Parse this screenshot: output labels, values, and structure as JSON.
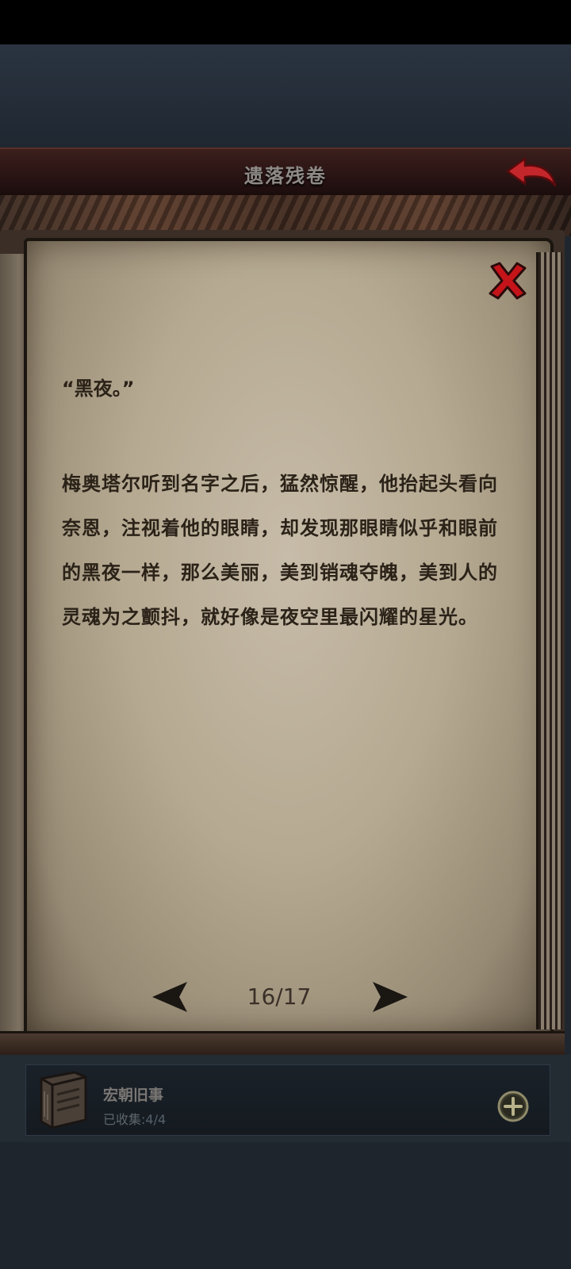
{
  "header": {
    "title": "遗落残卷",
    "back_icon": "back-arrow-icon"
  },
  "reader": {
    "close_icon": "close-x-icon",
    "quote": "“黑夜。”",
    "paragraph": "梅奥塔尔听到名字之后，猛然惊醒，他抬起头看向奈恩，注视着他的眼睛，却发现那眼睛似乎和眼前的黑夜一样，那么美丽，美到销魂夺魄，美到人的灵魂为之颤抖，就好像是夜空里最闪耀的星光。",
    "page_indicator": "16/17",
    "prev_icon": "left-arrow-icon",
    "next_icon": "right-arrow-icon"
  },
  "collection": {
    "icon": "book-icon",
    "title": "宏朝旧事",
    "status_label": "已收集:",
    "status_count": "4/4",
    "add_icon": "plus-circle-icon"
  },
  "colors": {
    "title_bar": "#2a1414",
    "parchment": "#b5a991",
    "text": "#2b2218",
    "close_red": "#c4141a",
    "background": "#1f262e"
  }
}
